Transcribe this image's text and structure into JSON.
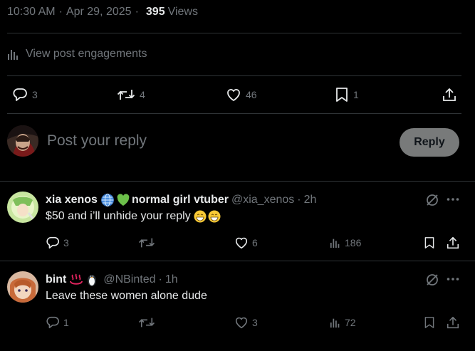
{
  "post_meta": {
    "time": "10:30 AM",
    "date": "Apr 29, 2025",
    "views_count": "395",
    "views_label": "Views"
  },
  "engagements": {
    "label": "View post engagements"
  },
  "actions": {
    "replies": "3",
    "reposts": "4",
    "likes": "46",
    "bookmarks": "1"
  },
  "compose": {
    "placeholder": "Post your reply",
    "reply_button": "Reply"
  },
  "replies": [
    {
      "name": "xia xenos",
      "name_suffix": "normal girl vtuber",
      "handle": "@xia_xenos",
      "time": "2h",
      "text": "$50 and i’ll unhide your reply",
      "replies": "3",
      "likes": "6",
      "views": "186"
    },
    {
      "name": "bint",
      "handle": "@NBinted",
      "time": "1h",
      "text": "Leave these women alone dude",
      "replies": "1",
      "likes": "3",
      "views": "72"
    }
  ],
  "colors": {
    "background": "#000000",
    "text_primary": "#e7e9ea",
    "text_secondary": "#71767b",
    "divider": "#2f3336",
    "reply_button_bg": "#787a7a"
  }
}
